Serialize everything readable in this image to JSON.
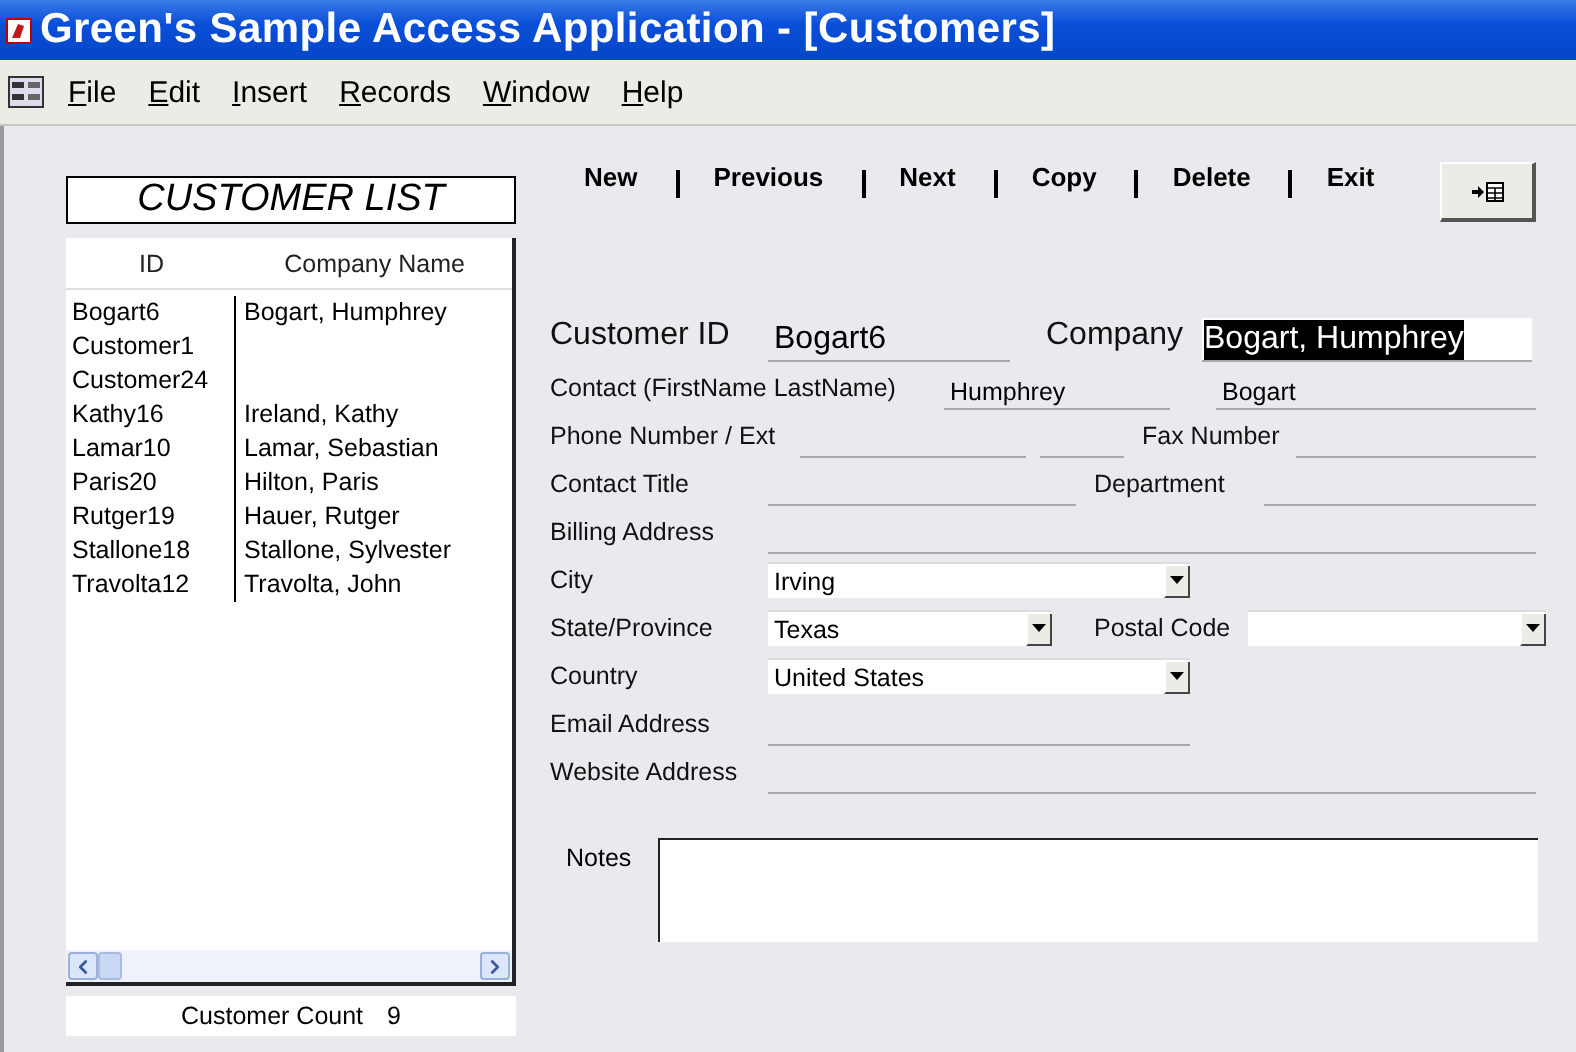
{
  "window": {
    "title": "Green's Sample Access Application - [Customers]"
  },
  "menu": [
    {
      "label": "File"
    },
    {
      "label": "Edit"
    },
    {
      "label": "Insert"
    },
    {
      "label": "Records"
    },
    {
      "label": "Window"
    },
    {
      "label": "Help"
    }
  ],
  "customer_list": {
    "title": "CUSTOMER LIST",
    "columns": [
      "ID",
      "Company Name"
    ],
    "rows": [
      {
        "id": "Bogart6",
        "company": "Bogart, Humphrey"
      },
      {
        "id": "Customer1",
        "company": ""
      },
      {
        "id": "Customer24",
        "company": ""
      },
      {
        "id": "Kathy16",
        "company": "Ireland, Kathy"
      },
      {
        "id": "Lamar10",
        "company": "Lamar, Sebastian"
      },
      {
        "id": "Paris20",
        "company": "Hilton, Paris"
      },
      {
        "id": "Rutger19",
        "company": "Hauer, Rutger"
      },
      {
        "id": "Stallone18",
        "company": "Stallone, Sylvester"
      },
      {
        "id": "Travolta12",
        "company": "Travolta, John"
      }
    ],
    "count_label": "Customer Count",
    "count": "9"
  },
  "toolbar": {
    "actions": [
      "New",
      "Previous",
      "Next",
      "Copy",
      "Delete",
      "Exit"
    ]
  },
  "form": {
    "customer_id": {
      "label": "Customer ID",
      "value": "Bogart6"
    },
    "company": {
      "label": "Company",
      "value": "Bogart, Humphrey",
      "selected": true
    },
    "contact": {
      "label": "Contact (FirstName LastName)",
      "first": "Humphrey",
      "last": "Bogart"
    },
    "phone": {
      "label": "Phone Number / Ext"
    },
    "fax": {
      "label": "Fax Number"
    },
    "contact_title": {
      "label": "Contact Title"
    },
    "department": {
      "label": "Department"
    },
    "billing_address": {
      "label": "Billing Address"
    },
    "city": {
      "label": "City",
      "value": "Irving"
    },
    "state": {
      "label": "State/Province",
      "value": "Texas"
    },
    "postal_code": {
      "label": "Postal Code"
    },
    "country": {
      "label": "Country",
      "value": "United States"
    },
    "email": {
      "label": "Email Address"
    },
    "website": {
      "label": "Website Address"
    },
    "notes": {
      "label": "Notes"
    }
  }
}
